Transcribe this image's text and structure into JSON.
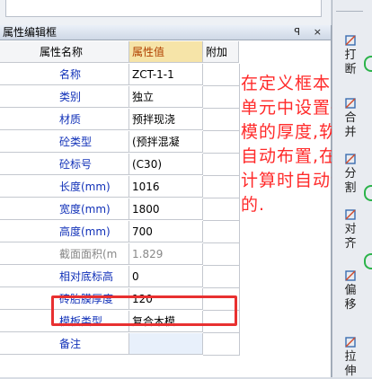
{
  "panel": {
    "title": "属性编辑框",
    "pin_glyph": "q",
    "close_glyph": "×",
    "headers": {
      "name": "属性名称",
      "value": "属性值",
      "extra": "附加"
    },
    "rows": [
      {
        "name": "名称",
        "value": "ZCT-1-1",
        "checkbox": false,
        "gray": false
      },
      {
        "name": "类别",
        "value": "独立",
        "checkbox": true,
        "gray": false
      },
      {
        "name": "材质",
        "value": "预拌现浇",
        "checkbox": true,
        "gray": false
      },
      {
        "name": "砼类型",
        "value": "(预拌混凝",
        "checkbox": true,
        "gray": false
      },
      {
        "name": "砼标号",
        "value": "(C30)",
        "checkbox": true,
        "gray": false
      },
      {
        "name": "长度(mm)",
        "value": "1016",
        "checkbox": true,
        "gray": false
      },
      {
        "name": "宽度(mm)",
        "value": "1800",
        "checkbox": true,
        "gray": false
      },
      {
        "name": "高度(mm)",
        "value": "700",
        "checkbox": true,
        "gray": false
      },
      {
        "name": "截面面积(m",
        "value": "1.829",
        "checkbox": true,
        "gray": true
      },
      {
        "name": "相对底标高",
        "value": "0",
        "checkbox": false,
        "gray": false
      },
      {
        "name": "砖胎膜厚度",
        "value": "120",
        "checkbox": true,
        "gray": false
      },
      {
        "name": "模板类型",
        "value": "复合木模",
        "checkbox": true,
        "gray": false
      },
      {
        "name": "备注",
        "value": "",
        "checkbox": true,
        "gray": false
      }
    ]
  },
  "annotation": {
    "text": "在定义框本台的单元中设置砖胎模的厚度,软件会自动布置,在汇总计算时自动计算的.",
    "color": "#ff2a2a"
  },
  "toolbar": {
    "items": [
      {
        "label": "打断",
        "icon": "break-icon"
      },
      {
        "label": "合并",
        "icon": "merge-icon"
      },
      {
        "label": "分割",
        "icon": "split-icon"
      },
      {
        "label": "对齐",
        "icon": "align-icon"
      },
      {
        "label": "偏移",
        "icon": "offset-icon"
      },
      {
        "label": "拉伸",
        "icon": "stretch-icon"
      }
    ]
  },
  "colors": {
    "name_text": "#1030b8",
    "header_value_bg": "#f6e4a8",
    "highlight": "#e83030"
  }
}
